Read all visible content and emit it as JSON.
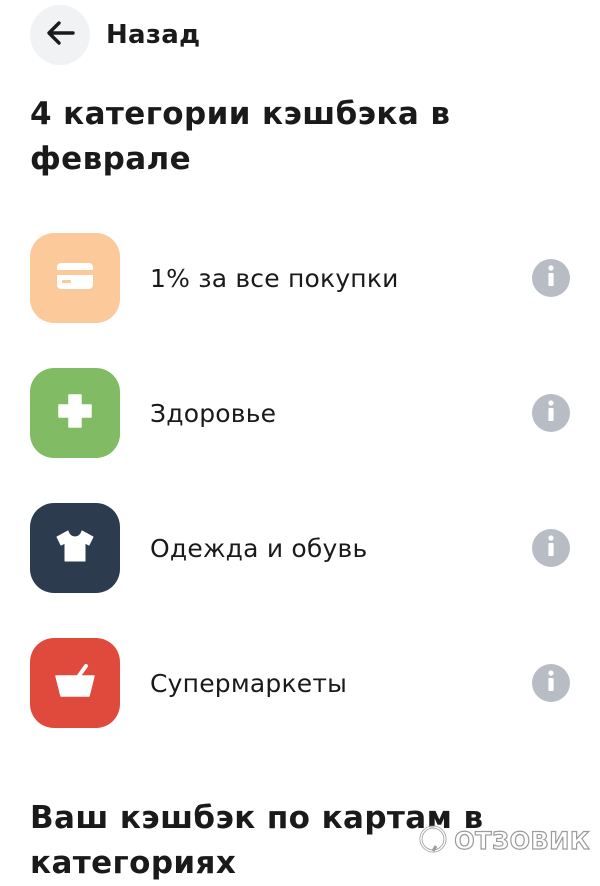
{
  "header": {
    "back_label": "Назад"
  },
  "title": "4 категории кэшбэка в феврале",
  "categories": [
    {
      "label": "1% за все покупки",
      "icon": "card-icon",
      "color": "#FCC99B"
    },
    {
      "label": "Здоровье",
      "icon": "health-cross-icon",
      "color": "#81BB63"
    },
    {
      "label": "Одежда и обувь",
      "icon": "tshirt-icon",
      "color": "#2D3B4F"
    },
    {
      "label": "Супермаркеты",
      "icon": "basket-icon",
      "color": "#DF4A3C"
    }
  ],
  "bottom_title": "Ваш кэшбэк по картам в категориях",
  "watermark": {
    "text": "ОТЗОВИК"
  }
}
